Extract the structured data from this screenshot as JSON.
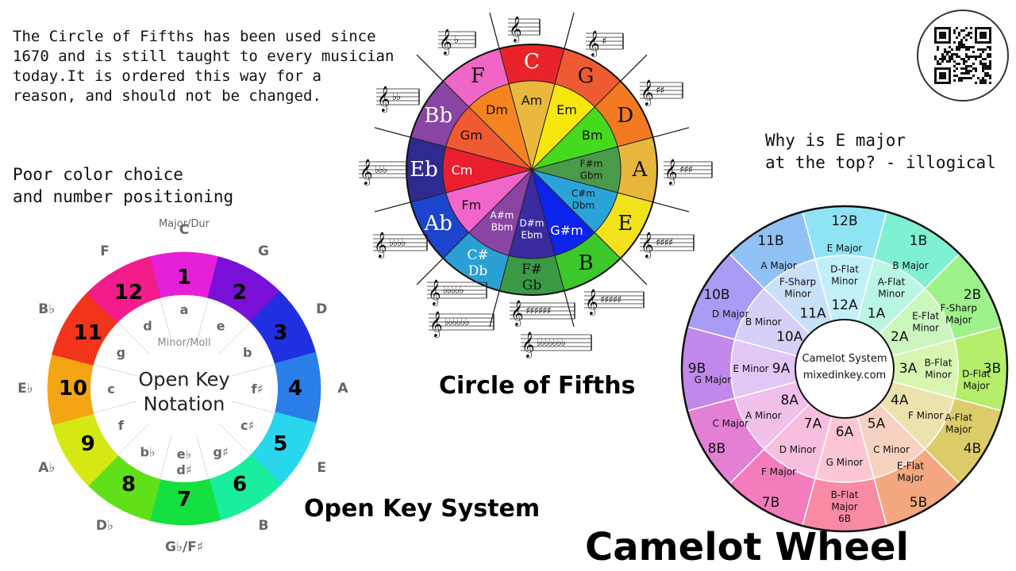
{
  "annotations": {
    "intro": "The Circle of Fifths has been used since\n1670 and is still taught to every musician\ntoday.It is ordered this way for a\nreason, and should not be changed.",
    "color_note": "Poor color choice\nand number positioning",
    "e_major_note": "Why is E major\nat the top? - illogical"
  },
  "titles": {
    "circle_of_fifths": "Circle of Fifths",
    "open_key": "Open Key System",
    "camelot": "Camelot Wheel"
  },
  "circle_of_fifths": {
    "major": [
      {
        "key": "C",
        "color": "#e8242a"
      },
      {
        "key": "G",
        "color": "#f05a32"
      },
      {
        "key": "D",
        "color": "#f37a20"
      },
      {
        "key": "A",
        "color": "#e8b63a"
      },
      {
        "key": "E",
        "color": "#f2e21c"
      },
      {
        "key": "B",
        "color": "#3cc82a"
      },
      {
        "key": "F#\nGb",
        "color": "#3a9a46"
      },
      {
        "key": "C#\nDb",
        "color": "#2aa0d4"
      },
      {
        "key": "Ab",
        "color": "#1c44cc"
      },
      {
        "key": "Eb",
        "color": "#2e2a90"
      },
      {
        "key": "Bb",
        "color": "#8a44a4"
      },
      {
        "key": "F",
        "color": "#f066c6"
      }
    ],
    "minor": [
      {
        "key": "Am",
        "color": "#e9b83c"
      },
      {
        "key": "Em",
        "color": "#f6e80f"
      },
      {
        "key": "Bm",
        "color": "#46da1e"
      },
      {
        "key": "F#m\nGbm",
        "color": "#4a9a4a"
      },
      {
        "key": "C#m\nDbm",
        "color": "#2aa4d8"
      },
      {
        "key": "G#m",
        "color": "#0c24ee"
      },
      {
        "key": "D#m\nEbm",
        "color": "#3a2aa0"
      },
      {
        "key": "A#m\nBbm",
        "color": "#8a44a4"
      },
      {
        "key": "Fm",
        "color": "#f266cc"
      },
      {
        "key": "Cm",
        "color": "#ea1e2e"
      },
      {
        "key": "Gm",
        "color": "#f05a32"
      },
      {
        "key": "Dm",
        "color": "#f58420"
      }
    ],
    "key_signatures": [
      "",
      "♯",
      "♯♯",
      "♯♯♯",
      "♯♯♯♯",
      "♯♯♯♯♯",
      "♯♯♯♯♯♯",
      "♭♭♭♭♭",
      "♭♭♭♭",
      "♭♭♭",
      "♭♭",
      "♭"
    ],
    "extra_signatures": [
      "♯♯♯♯♯♯♯",
      "♭♭♭♭♭♭",
      "♭♭♭♭♭♭♭"
    ]
  },
  "open_key": {
    "center_text": "Open Key\nNotation",
    "outer_heading": "Major/Dur",
    "inner_heading": "Minor/Moll",
    "numbers": [
      "1",
      "2",
      "3",
      "4",
      "5",
      "6",
      "7",
      "8",
      "9",
      "10",
      "11",
      "12"
    ],
    "major_keys": [
      "C",
      "G",
      "D",
      "A",
      "E",
      "B",
      "G♭/F♯",
      "D♭",
      "A♭",
      "E♭",
      "B♭",
      "F"
    ],
    "minor_keys": [
      "a",
      "e",
      "b",
      "f♯",
      "c♯",
      "g♯",
      "e♭\nd♯",
      "b♭",
      "f",
      "c",
      "g",
      "d"
    ],
    "ring_colors": [
      "#e620d8",
      "#7a10d8",
      "#2030e0",
      "#2a7ee8",
      "#28d6ee",
      "#18ee9c",
      "#14e040",
      "#60e018",
      "#d6e814",
      "#f4a514",
      "#f2341a",
      "#f21c8a"
    ]
  },
  "camelot": {
    "center_title": "Camelot System",
    "center_site": "mixedinkey.com",
    "outer": [
      {
        "code": "12B",
        "label": "E Major",
        "color": "#8fe4f4"
      },
      {
        "code": "1B",
        "label": "B Major",
        "color": "#7ff0d2"
      },
      {
        "code": "2B",
        "label": "F-Sharp\nMajor",
        "color": "#9ef28a"
      },
      {
        "code": "3B",
        "label": "D-Flat\nMajor",
        "color": "#b4ee6a"
      },
      {
        "code": "4B",
        "label": "A-Flat\nMajor",
        "color": "#dccc6a"
      },
      {
        "code": "5B",
        "label": "E-Flat\nMajor",
        "color": "#f4a880"
      },
      {
        "code": "6B",
        "label": "B-Flat\nMajor\n6B",
        "color": "#f88aa4"
      },
      {
        "code": "7B",
        "label": "F Major",
        "color": "#f47cbc"
      },
      {
        "code": "8B",
        "label": "C Major",
        "color": "#e480d4"
      },
      {
        "code": "9B",
        "label": "G Major",
        "color": "#c288ec"
      },
      {
        "code": "10B",
        "label": "D Major",
        "color": "#aa9cf4"
      },
      {
        "code": "11B",
        "label": "A Major",
        "color": "#90c2f6"
      }
    ],
    "inner": [
      {
        "code": "12A",
        "label": "D-Flat\nMinor",
        "color": "#c2f0f8"
      },
      {
        "code": "1A",
        "label": "A-Flat\nMinor",
        "color": "#baf6e4"
      },
      {
        "code": "2A",
        "label": "E-Flat\nMinor",
        "color": "#cbf6be"
      },
      {
        "code": "3A",
        "label": "B-Flat\nMinor",
        "color": "#d8f6b0"
      },
      {
        "code": "4A",
        "label": "F Minor",
        "color": "#ece2ae"
      },
      {
        "code": "5A",
        "label": "C Minor",
        "color": "#f8d2c0"
      },
      {
        "code": "6A",
        "label": "G Minor",
        "color": "#fcc6d2"
      },
      {
        "code": "7A",
        "label": "D Minor",
        "color": "#f8bede"
      },
      {
        "code": "8A",
        "label": "A Minor",
        "color": "#f0c0ea"
      },
      {
        "code": "9A",
        "label": "E Minor",
        "color": "#e2c6f6"
      },
      {
        "code": "10A",
        "label": "B Minor",
        "color": "#d6d0f8"
      },
      {
        "code": "11A",
        "label": "F-Sharp\nMinor",
        "color": "#c8e0fa"
      }
    ]
  }
}
